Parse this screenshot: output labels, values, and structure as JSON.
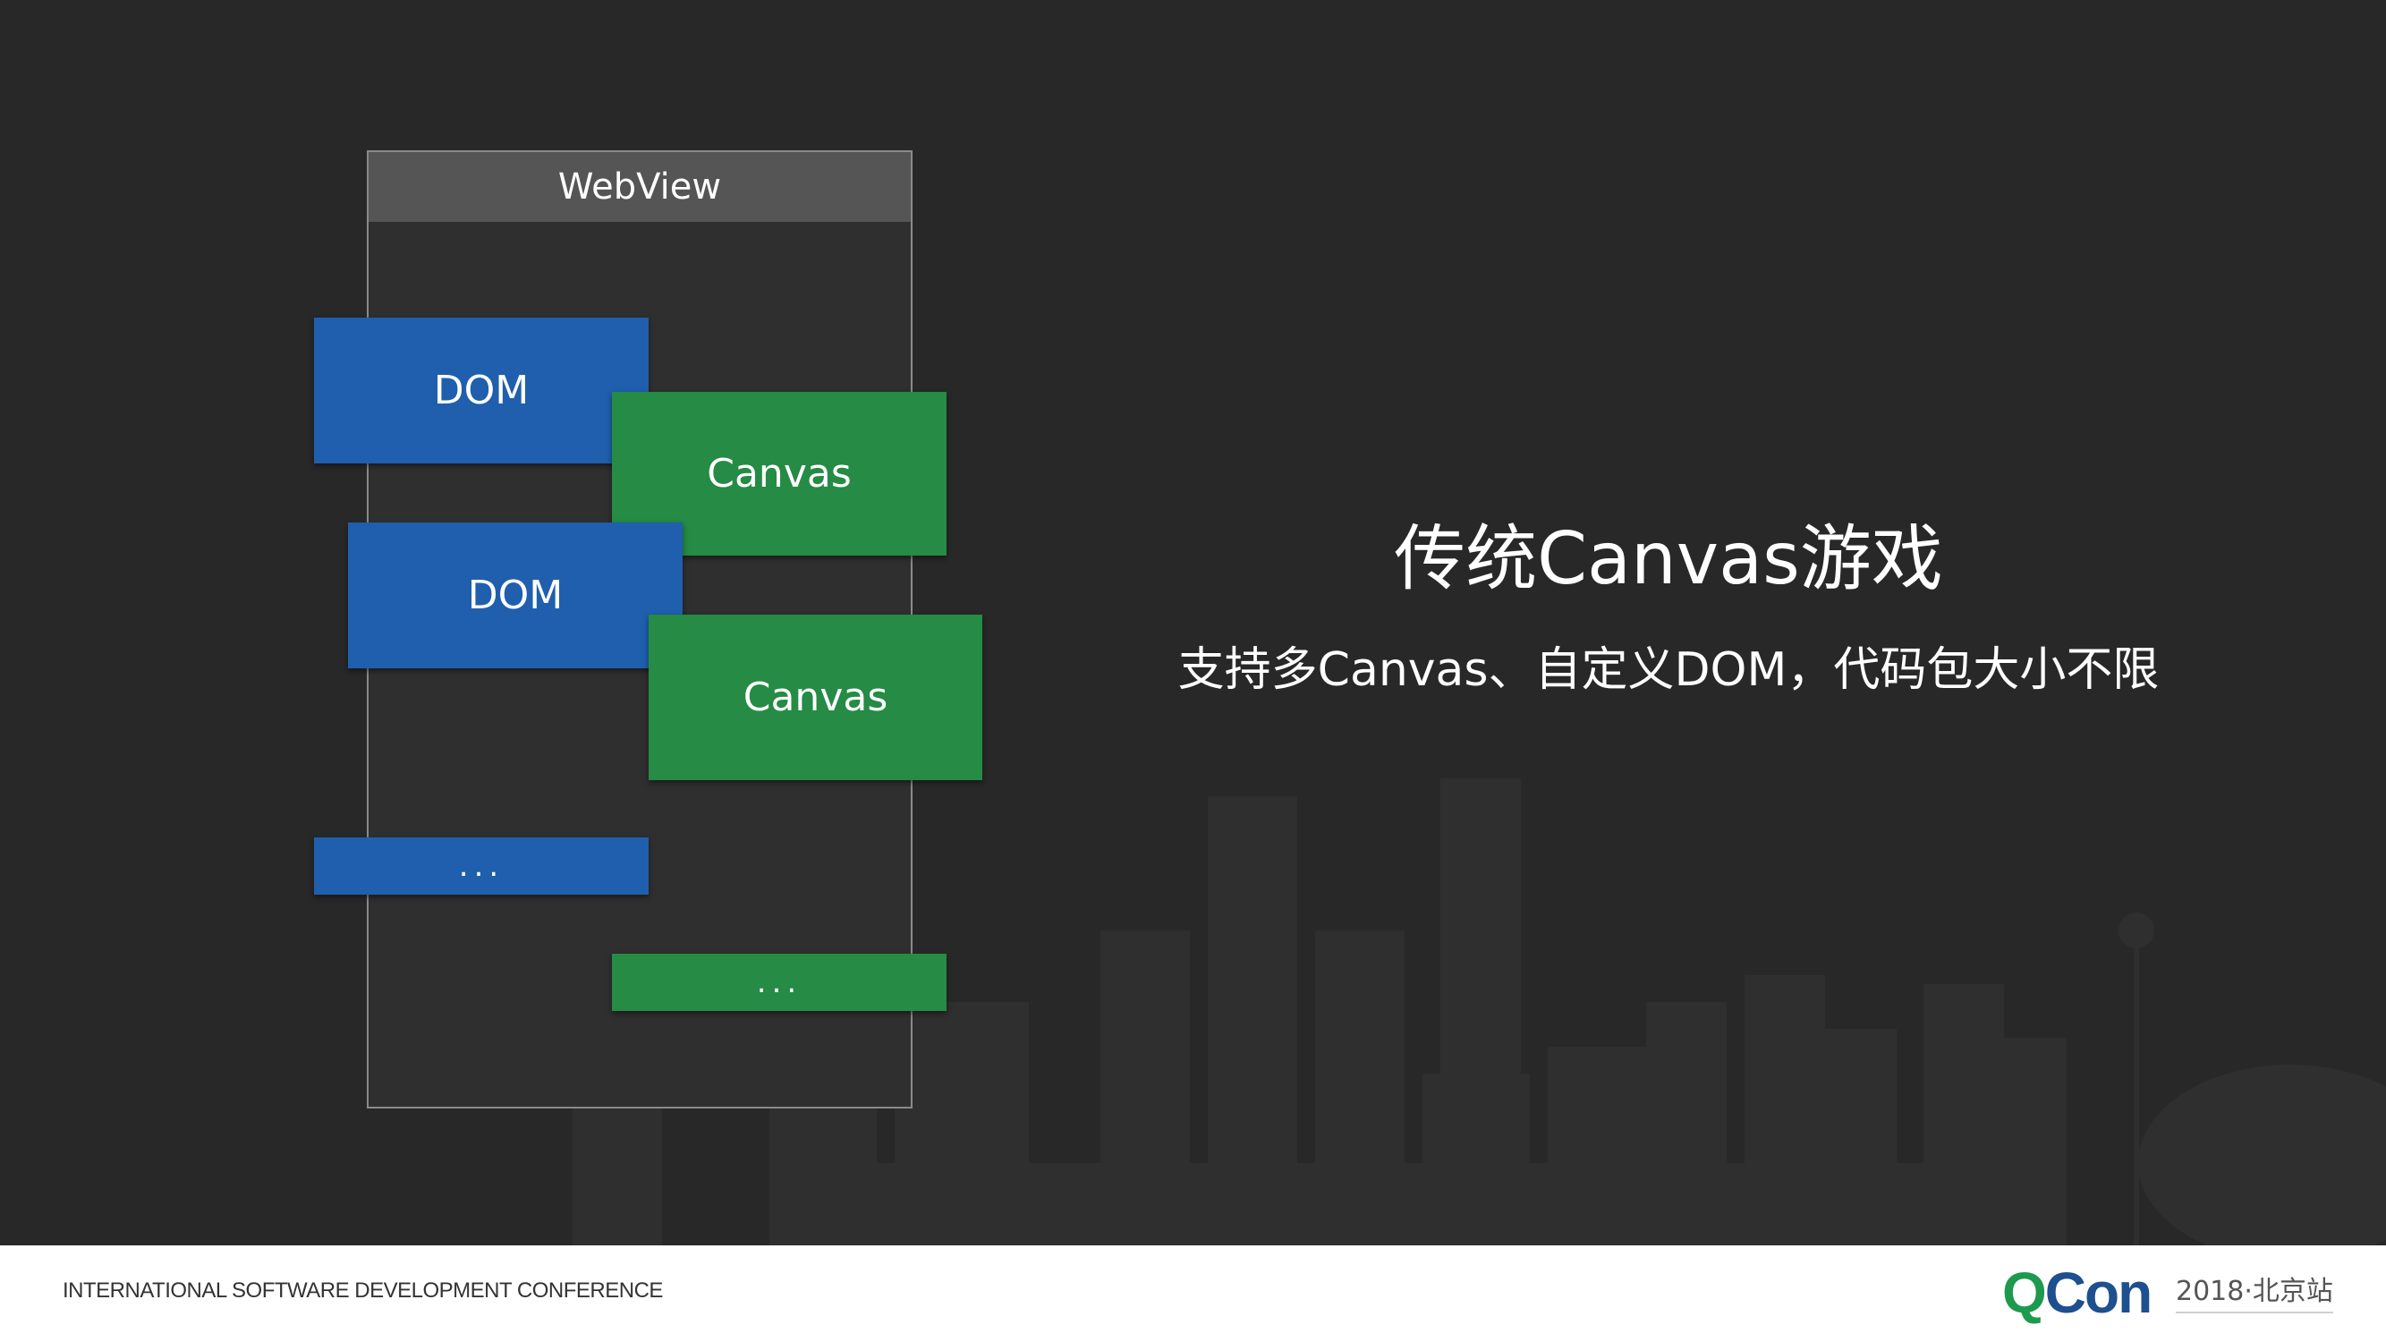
{
  "diagram": {
    "webview_label": "WebView",
    "dom_1": "DOM",
    "canvas_1": "Canvas",
    "dom_2": "DOM",
    "canvas_2": "Canvas",
    "dom_more": "...",
    "canvas_more": "...",
    "colors": {
      "dom": "#1f5fad",
      "canvas": "#258b45",
      "webview_header": "#555555"
    }
  },
  "content": {
    "title": "传统Canvas游戏",
    "subtitle": "支持多Canvas、自定义DOM，代码包大小不限"
  },
  "footer": {
    "conference": "INTERNATIONAL SOFTWARE DEVELOPMENT CONFERENCE",
    "logo_q": "Q",
    "logo_con": "Con",
    "edition": "2018·北京站",
    "colors": {
      "logo_q": "#1d9a4d",
      "logo_con": "#1e4f8e"
    }
  }
}
